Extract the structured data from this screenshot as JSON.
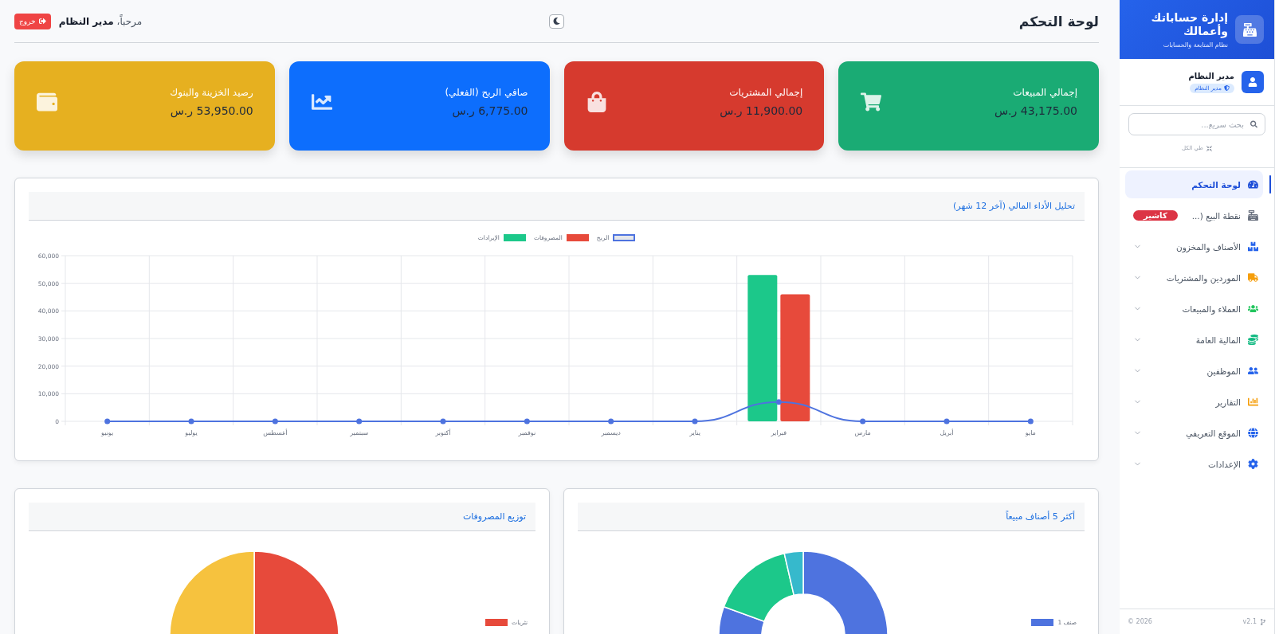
{
  "sidebar": {
    "brand": {
      "title": "إدارة حساباتك وأعمالك",
      "subtitle": "نظام المتابعة والحسابات"
    },
    "user": {
      "name": "مدير النظام",
      "role": "مدير النظام"
    },
    "search": {
      "placeholder": "بحث سريع..."
    },
    "collapse_all": "طي الكل",
    "nav": [
      {
        "label": "لوحة التحكم",
        "kind": "link",
        "selected": true
      },
      {
        "label": "نقطة البيع (...",
        "kind": "badge",
        "badge": "كاشير",
        "selected": false
      },
      {
        "label": "الأصناف والمخزون",
        "kind": "group",
        "selected": false
      },
      {
        "label": "الموردين والمشتريات",
        "kind": "group",
        "selected": false
      },
      {
        "label": "العملاء والمبيعات",
        "kind": "group",
        "selected": false
      },
      {
        "label": "المالية العامة",
        "kind": "group",
        "selected": false
      },
      {
        "label": "الموظفين",
        "kind": "group",
        "selected": false
      },
      {
        "label": "التقارير",
        "kind": "group",
        "selected": false
      },
      {
        "label": "الموقع التعريفي",
        "kind": "group",
        "selected": false
      },
      {
        "label": "الإعدادات",
        "kind": "group",
        "selected": false
      }
    ],
    "footer": {
      "version": "v2.1",
      "copyright": "2026 ©"
    }
  },
  "header": {
    "title": "لوحة التحكم",
    "welcome": "مرحباً، **مدير النظام**",
    "logout": "خروج"
  },
  "stats": [
    {
      "title": "إجمالي المبيعات",
      "value": "43,175.00 ر.س",
      "color": "#1aab74"
    },
    {
      "title": "إجمالي المشتريات",
      "value": "11,900.00 ر.س",
      "color": "#d63a2e"
    },
    {
      "title": "صافي الربح (الفعلي)",
      "value": "6,775.00 ر.س",
      "color": "#0d6efd"
    },
    {
      "title": "رصيد الخزينة والبنوك",
      "value": "53,950.00 ر.س",
      "color": "#e6b020"
    }
  ],
  "performance": {
    "title": "تحليل الأداء المالي (آخر 12 شهر)",
    "chart_data": {
      "type": "bar",
      "categories": [
        "يونيو",
        "يوليو",
        "أغسطس",
        "سبتمبر",
        "أكتوبر",
        "نوفمبر",
        "ديسمبر",
        "يناير",
        "فبراير",
        "مارس",
        "أبريل",
        "مايو"
      ],
      "series": [
        {
          "name": "الربح",
          "color": "#4e73df",
          "type": "line",
          "marker": true,
          "values": [
            0,
            0,
            0,
            0,
            0,
            0,
            0,
            0,
            7000,
            0,
            0,
            0
          ]
        },
        {
          "name": "المصروفات",
          "color": "#e74a3b",
          "type": "bar",
          "values": [
            0,
            0,
            0,
            0,
            0,
            0,
            0,
            0,
            46000,
            0,
            0,
            0
          ]
        },
        {
          "name": "الإيرادات",
          "color": "#1cc88a",
          "type": "bar",
          "values": [
            0,
            0,
            0,
            0,
            0,
            0,
            0,
            0,
            53000,
            0,
            0,
            0
          ]
        }
      ],
      "ylim": [
        0,
        60000
      ],
      "grid": true,
      "legend": "top",
      "yticks": [
        {
          "value": 0,
          "label": "0"
        },
        {
          "value": 10000,
          "label": "10,000"
        },
        {
          "value": 20000,
          "label": "20,000"
        },
        {
          "value": 30000,
          "label": "30,000"
        },
        {
          "value": 40000,
          "label": "40,000"
        },
        {
          "value": 50000,
          "label": "50,000"
        },
        {
          "value": 60000,
          "label": "60,000"
        }
      ]
    }
  },
  "top_items": {
    "title": "أكثر 5 أصناف مبيعاً",
    "legend": [
      {
        "label": "صنف 1",
        "color": "#4e73df"
      }
    ]
  },
  "expenses": {
    "title": "توزيع المصروفات",
    "legend": [
      {
        "label": "نثريات",
        "color": "#e74a3b"
      }
    ]
  }
}
